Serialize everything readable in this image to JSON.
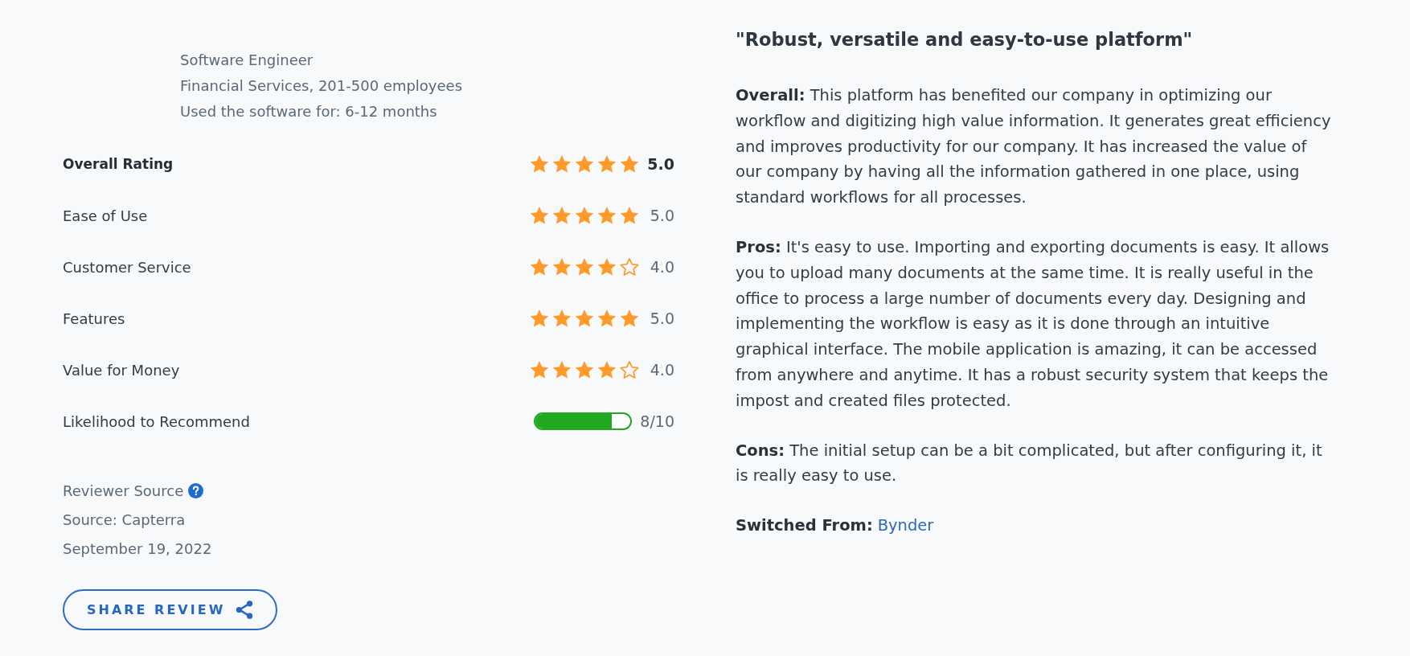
{
  "reviewer": {
    "job_title": "Software Engineer",
    "industry": "Financial Services, 201-500 employees",
    "usage": "Used the software for: 6-12 months"
  },
  "ratings": [
    {
      "label": "Overall Rating",
      "kind": "overall",
      "stars": 5,
      "score": "5.0"
    },
    {
      "label": "Ease of Use",
      "kind": "stars",
      "stars": 5,
      "score": "5.0"
    },
    {
      "label": "Customer Service",
      "kind": "stars",
      "stars": 4,
      "score": "4.0"
    },
    {
      "label": "Features",
      "kind": "stars",
      "stars": 5,
      "score": "5.0"
    },
    {
      "label": "Value for Money",
      "kind": "stars",
      "stars": 4,
      "score": "4.0"
    },
    {
      "label": "Likelihood to Recommend",
      "kind": "meter",
      "level": 0.8,
      "score": "8/10"
    }
  ],
  "source": {
    "label": "Reviewer Source",
    "name": "Source: Capterra",
    "date": "September 19, 2022"
  },
  "share_button": {
    "label": "SHARE REVIEW"
  },
  "review": {
    "title": "\"Robust, versatile and easy-to-use platform\"",
    "sections": [
      "**Overall:** This platform has benefited our company in optimizing our workflow and digitizing high value information. It generates great efficiency and improves productivity for our company. It has increased the value of our company by having all the information gathered in one place, using standard workflows for all processes.",
      "**Pros:** It's easy to use. Importing and exporting documents is easy. It allows you to upload many documents at the same time. It is really useful in the office to process a large number of documents every day. Designing and implementing the workflow is easy as it is done through an intuitive graphical interface. The mobile application is amazing, it can be accessed from anywhere and anytime. It has a robust security system that keeps the impost and created files protected.",
      "**Cons:** The initial setup can be a bit complicated, but after configuring it, it is really easy to use."
    ],
    "switched_from": {
      "label": "Switched From:",
      "link": "Bynder"
    }
  }
}
